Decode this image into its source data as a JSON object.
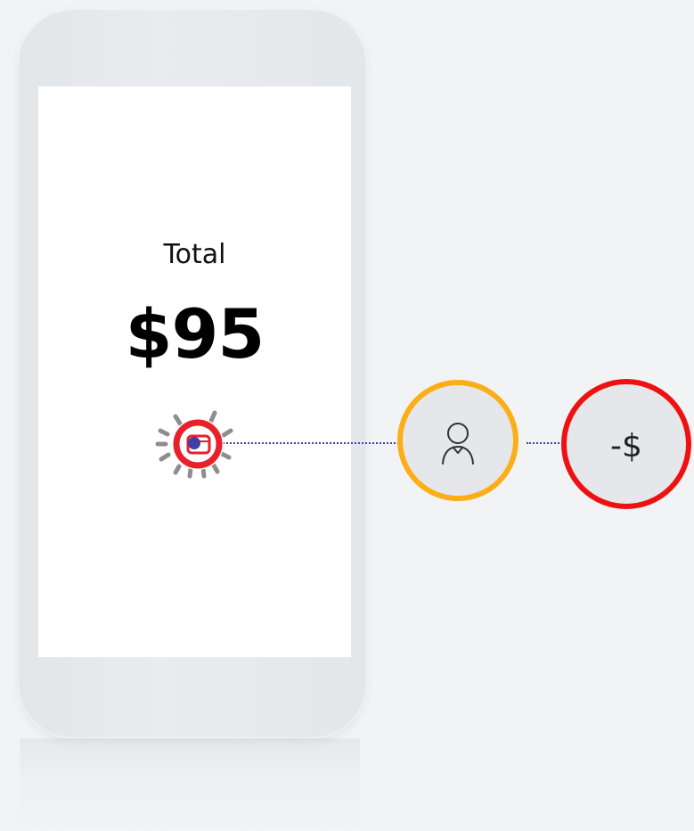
{
  "payment": {
    "label": "Total",
    "amount": "$95"
  },
  "flow": {
    "nodes": [
      {
        "name": "tap-pay",
        "icon": "nfc-card-icon"
      },
      {
        "name": "customer",
        "icon": "user-icon"
      },
      {
        "name": "debit",
        "label": "-$"
      }
    ]
  },
  "colors": {
    "background": "#f2f3f5",
    "phone_body": "#e6e9ec",
    "screen": "#ffffff",
    "tap_ring": "#e8202a",
    "tap_dot": "#3f3fa5",
    "connector": "#3f3fa5",
    "user_ring": "#fbae17",
    "debit_ring": "#ee1111",
    "node_fill": "#e5e7ea"
  }
}
